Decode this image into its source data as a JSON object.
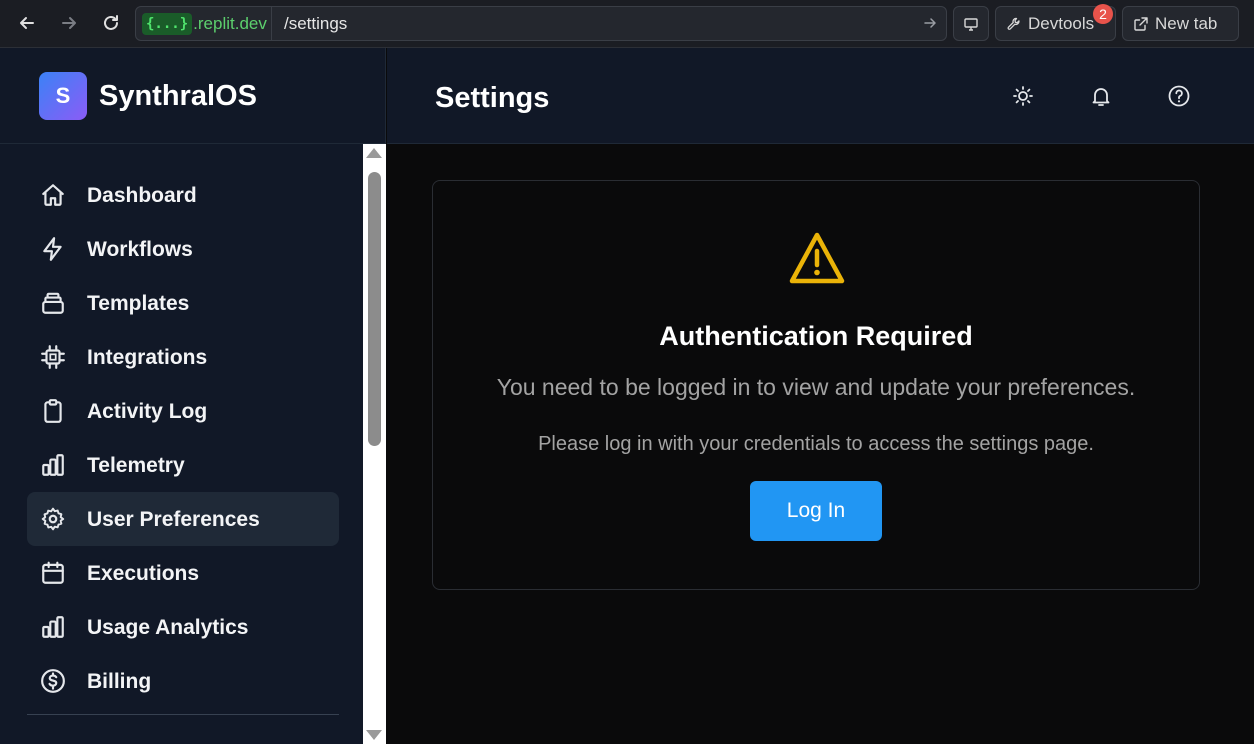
{
  "browser": {
    "url_badge": "{...}",
    "url_domain": ".replit.dev",
    "url_path": "/settings",
    "devtools_label": "Devtools",
    "devtools_count": "2",
    "newtab_label": "New tab"
  },
  "app": {
    "logo_letter": "S",
    "name": "SynthralOS",
    "page_title": "Settings"
  },
  "sidebar": {
    "items": [
      {
        "label": "Dashboard",
        "icon": "home-icon",
        "active": false
      },
      {
        "label": "Workflows",
        "icon": "lightning-icon",
        "active": false
      },
      {
        "label": "Templates",
        "icon": "layers-icon",
        "active": false
      },
      {
        "label": "Integrations",
        "icon": "chip-icon",
        "active": false
      },
      {
        "label": "Activity Log",
        "icon": "clipboard-icon",
        "active": false
      },
      {
        "label": "Telemetry",
        "icon": "bar-chart-icon",
        "active": false
      },
      {
        "label": "User Preferences",
        "icon": "gear-icon",
        "active": true
      },
      {
        "label": "Executions",
        "icon": "calendar-icon",
        "active": false
      },
      {
        "label": "Usage Analytics",
        "icon": "bar-chart-icon",
        "active": false
      },
      {
        "label": "Billing",
        "icon": "dollar-icon",
        "active": false
      }
    ]
  },
  "header": {
    "icons": [
      "sun-icon",
      "bell-icon",
      "help-icon"
    ]
  },
  "auth": {
    "title": "Authentication Required",
    "subtitle": "You need to be logged in to view and update your preferences.",
    "note": "Please log in with your credentials to access the settings page.",
    "login_label": "Log In"
  },
  "colors": {
    "accent": "#2196f3",
    "warning": "#eab308",
    "sidebar_bg": "#111827",
    "main_bg": "#0a0a0b"
  }
}
